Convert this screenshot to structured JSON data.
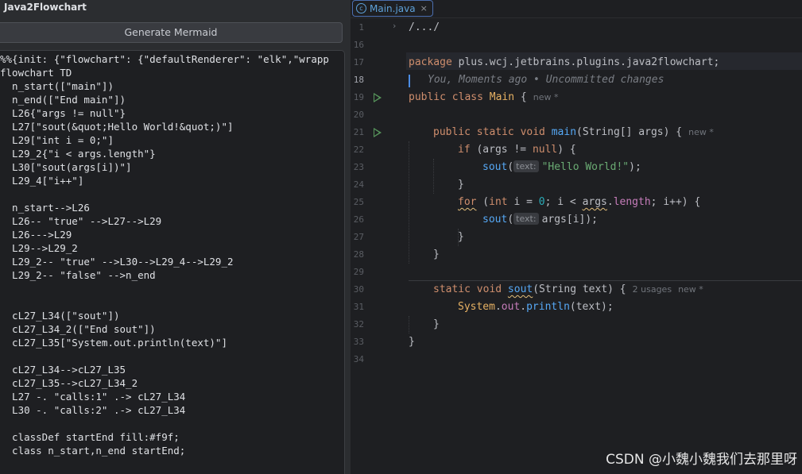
{
  "tool_window": {
    "title": "Java2Flowchart",
    "generate_button": "Generate Mermaid",
    "mermaid_lines": [
      "%%{init: {\"flowchart\": {\"defaultRenderer\": \"elk\",\"wrapp",
      "flowchart TD",
      "  n_start([\"main\"])",
      "  n_end([\"End main\"])",
      "  L26{\"args != null\"}",
      "  L27[\"sout(&quot;Hello World!&quot;)\"]",
      "  L29[\"int i = 0;\"]",
      "  L29_2{\"i < args.length\"}",
      "  L30[\"sout(args[i])\"]",
      "  L29_4[\"i++\"]",
      "",
      "  n_start-->L26",
      "  L26-- \"true\" -->L27-->L29",
      "  L26--->L29",
      "  L29-->L29_2",
      "  L29_2-- \"true\" -->L30-->L29_4-->L29_2",
      "  L29_2-- \"false\" -->n_end",
      "",
      "",
      "  cL27_L34([\"sout\"])",
      "  cL27_L34_2([\"End sout\"])",
      "  cL27_L35[\"System.out.println(text)\"]",
      "",
      "  cL27_L34-->cL27_L35",
      "  cL27_L35-->cL27_L34_2",
      "  L27 -. \"calls:1\" .-> cL27_L34",
      "  L30 -. \"calls:2\" .-> cL27_L34",
      "",
      "  classDef startEnd fill:#f9f;",
      "  class n_start,n_end startEnd;"
    ]
  },
  "editor": {
    "tab": {
      "label": "Main.java",
      "icon": "java-class-icon",
      "close": "×"
    },
    "line_numbers": [
      "1",
      "16",
      "17",
      "18",
      "19",
      "20",
      "21",
      "22",
      "23",
      "24",
      "25",
      "26",
      "27",
      "28",
      "29",
      "30",
      "31",
      "32",
      "33",
      "34"
    ],
    "current_line": "18",
    "fold_chevron": "›",
    "code": {
      "l1_collapsed": "/.../",
      "l17_package_kw": "package",
      "l17_package_name": " plus.wcj.jetbrains.plugins.java2flowchart;",
      "l18_blame": "You, Moments ago • Uncommitted changes",
      "l19_public": "public",
      "l19_class": " class ",
      "l19_name": "Main",
      "l19_brace": " {",
      "l19_meta": "new *",
      "l21_mods": "public static void ",
      "l21_fn": "main",
      "l21_params_a": "(String[] args) {",
      "l21_meta": "new *",
      "l22_if": "if",
      "l22_rest_a": " (args != ",
      "l22_null": "null",
      "l22_rest_b": ") {",
      "l23_fn": "sout",
      "l23_open": "(",
      "l23_hint": "text:",
      "l23_str": "\"Hello World!\"",
      "l23_close": ");",
      "l24": "}",
      "l25_for": "for",
      "l25_a": " (",
      "l25_int": "int",
      "l25_b": " i = ",
      "l25_zero": "0",
      "l25_c": "; i < ",
      "l25_args": "args",
      "l25_dot": ".",
      "l25_length": "length",
      "l25_d": "; i++) {",
      "l26_fn": "sout",
      "l26_open": "(",
      "l26_hint": "text:",
      "l26_arg": "args[i]);",
      "l27": "}",
      "l28": "}",
      "l30_mods": "static void ",
      "l30_fn": "sout",
      "l30_params": "(String text) {",
      "l30_usages": "2 usages",
      "l30_meta": "new *",
      "l31_system": "System",
      "l31_dot": ".",
      "l31_out": "out",
      "l31_rest_a": ".",
      "l31_println": "println",
      "l31_rest_b": "(text);",
      "l32": "}",
      "l33": "}"
    }
  },
  "watermark": "CSDN @小魏小魏我们去那里呀",
  "colors": {
    "keyword": "#cf8e6d",
    "class_name": "#e6b163",
    "string": "#6aab73",
    "function": "#56a8f5",
    "field": "#c77dbb",
    "number": "#2aacb8",
    "run_gutter": "#57965c",
    "tab_accent": "#5ea1d9"
  }
}
